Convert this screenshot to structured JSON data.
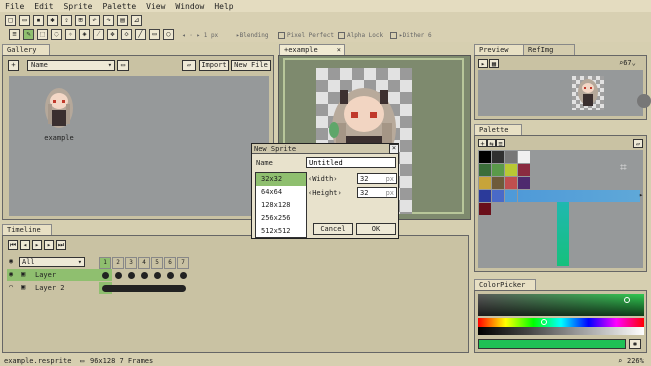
{
  "menu": [
    "File",
    "Edit",
    "Sprite",
    "Palette",
    "View",
    "Window",
    "Help"
  ],
  "options": {
    "brush_size": "1",
    "brush_unit": "px",
    "blending": "Blending",
    "pixel_perfect": "Pixel Perfect",
    "alpha_lock": "Alpha Lock",
    "dither": "Dither",
    "dither_value": "6"
  },
  "gallery": {
    "tab": "Gallery",
    "sort_value": "Name",
    "import_label": "Import",
    "new_file_label": "New File",
    "item_name": "example"
  },
  "editor": {
    "tab": "+example"
  },
  "preview": {
    "tab": "Preview",
    "tab2": "RefImg",
    "zoom": "67"
  },
  "palette": {
    "tab": "Palette"
  },
  "timeline": {
    "tab": "Timeline",
    "filter_value": "All",
    "frames": [
      "1",
      "2",
      "3",
      "4",
      "5",
      "6",
      "7"
    ],
    "layers": [
      "Layer",
      "Layer 2"
    ]
  },
  "colorpicker": {
    "tab": "ColorPicker"
  },
  "dialog": {
    "title": "New Sprite",
    "name_label": "Name",
    "name_value": "Untitled",
    "sizes": [
      "32x32",
      "64x64",
      "128x128",
      "256x256",
      "512x512"
    ],
    "selected_size": "32x32",
    "width_label": "Width",
    "width_value": "32",
    "height_label": "Height",
    "height_value": "32",
    "unit": "px",
    "cancel_label": "Cancel",
    "ok_label": "OK"
  },
  "status": {
    "filename": "example.resprite",
    "info": "96x128 7 Frames",
    "zoom": "226%"
  },
  "colors": {
    "accent": "#8fbf6f",
    "panel": "#c9c2a3",
    "workspace": "#7e8a6e",
    "viewport": "#96999a"
  }
}
